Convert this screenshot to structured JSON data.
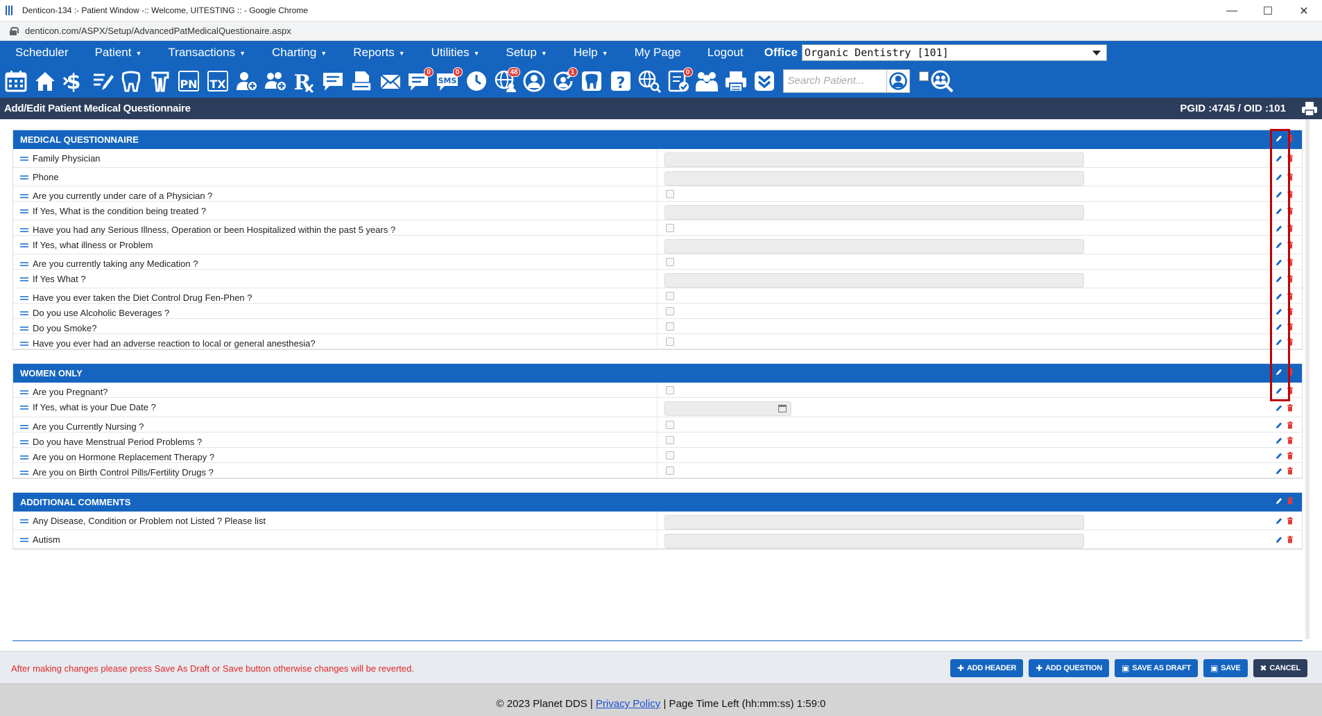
{
  "window": {
    "title": "Denticon-134 :- Patient Window -:: Welcome, UITESTING :: - Google Chrome",
    "url": "denticon.com/ASPX/Setup/AdvancedPatMedicalQuestionaire.aspx"
  },
  "nav": {
    "items": [
      {
        "label": "Scheduler",
        "caret": false
      },
      {
        "label": "Patient",
        "caret": true
      },
      {
        "label": "Transactions",
        "caret": true
      },
      {
        "label": "Charting",
        "caret": true
      },
      {
        "label": "Reports",
        "caret": true
      },
      {
        "label": "Utilities",
        "caret": true
      },
      {
        "label": "Setup",
        "caret": true
      },
      {
        "label": "Help",
        "caret": true
      },
      {
        "label": "My Page",
        "caret": false
      },
      {
        "label": "Logout",
        "caret": false
      }
    ],
    "office_label": "Office",
    "office_value": "Organic Dentistry [101]"
  },
  "toolbar": {
    "badges": {
      "sms": "0",
      "messages": "0",
      "globe": "48",
      "reminder": "1",
      "forms": "0"
    },
    "search_placeholder": "Search Patient..."
  },
  "page": {
    "title": "Add/Edit Patient Medical Questionnaire",
    "ids": "PGID :4745 / OID :101"
  },
  "sections": [
    {
      "title": "MEDICAL QUESTIONNAIRE",
      "questions": [
        {
          "text": "Family Physician",
          "type": "text"
        },
        {
          "text": "Phone",
          "type": "text"
        },
        {
          "text": "Are you currently under care of a Physician ?",
          "type": "checkbox"
        },
        {
          "text": "If Yes, What is the condition being treated ?",
          "type": "text"
        },
        {
          "text": "Have you had any Serious Illness, Operation or been Hospitalized within the past 5 years ?",
          "type": "checkbox"
        },
        {
          "text": "If Yes, what illness or Problem",
          "type": "text"
        },
        {
          "text": "Are you currently taking any Medication ?",
          "type": "checkbox"
        },
        {
          "text": "If Yes What ?",
          "type": "text"
        },
        {
          "text": "Have you ever taken the Diet Control Drug Fen-Phen ?",
          "type": "checkbox"
        },
        {
          "text": "Do you use Alcoholic Beverages ?",
          "type": "checkbox"
        },
        {
          "text": "Do you Smoke?",
          "type": "checkbox"
        },
        {
          "text": "Have you ever had an adverse reaction to local or general anesthesia?",
          "type": "checkbox"
        }
      ]
    },
    {
      "title": "WOMEN ONLY",
      "questions": [
        {
          "text": "Are you Pregnant?",
          "type": "checkbox"
        },
        {
          "text": "If Yes, what is your Due Date ?",
          "type": "date"
        },
        {
          "text": "Are you Currently Nursing ?",
          "type": "checkbox"
        },
        {
          "text": "Do you have Menstrual Period Problems ?",
          "type": "checkbox"
        },
        {
          "text": "Are you on Hormone Replacement Therapy ?",
          "type": "checkbox"
        },
        {
          "text": "Are you on Birth Control Pills/Fertility Drugs ?",
          "type": "checkbox"
        }
      ]
    },
    {
      "title": "ADDITIONAL COMMENTS",
      "questions": [
        {
          "text": "Any Disease, Condition or Problem not Listed ? Please list",
          "type": "text"
        },
        {
          "text": "Autism",
          "type": "text"
        }
      ]
    }
  ],
  "footer": {
    "warning": "After making changes please press Save As Draft or Save button otherwise changes will be reverted.",
    "buttons": {
      "add_header": "ADD HEADER",
      "add_question": "ADD QUESTION",
      "save_draft": "SAVE AS DRAFT",
      "save": "SAVE",
      "cancel": "CANCEL"
    },
    "copyright": "© 2023 Planet DDS |",
    "privacy": "Privacy Policy",
    "time_left": "| Page Time Left (hh:mm:ss) 1:59:0"
  },
  "colors": {
    "primary": "#1565c0",
    "header_dark": "#2c3e5c",
    "warning": "#e0262b",
    "highlight": "#c00000",
    "delete_icon": "#e53935"
  }
}
